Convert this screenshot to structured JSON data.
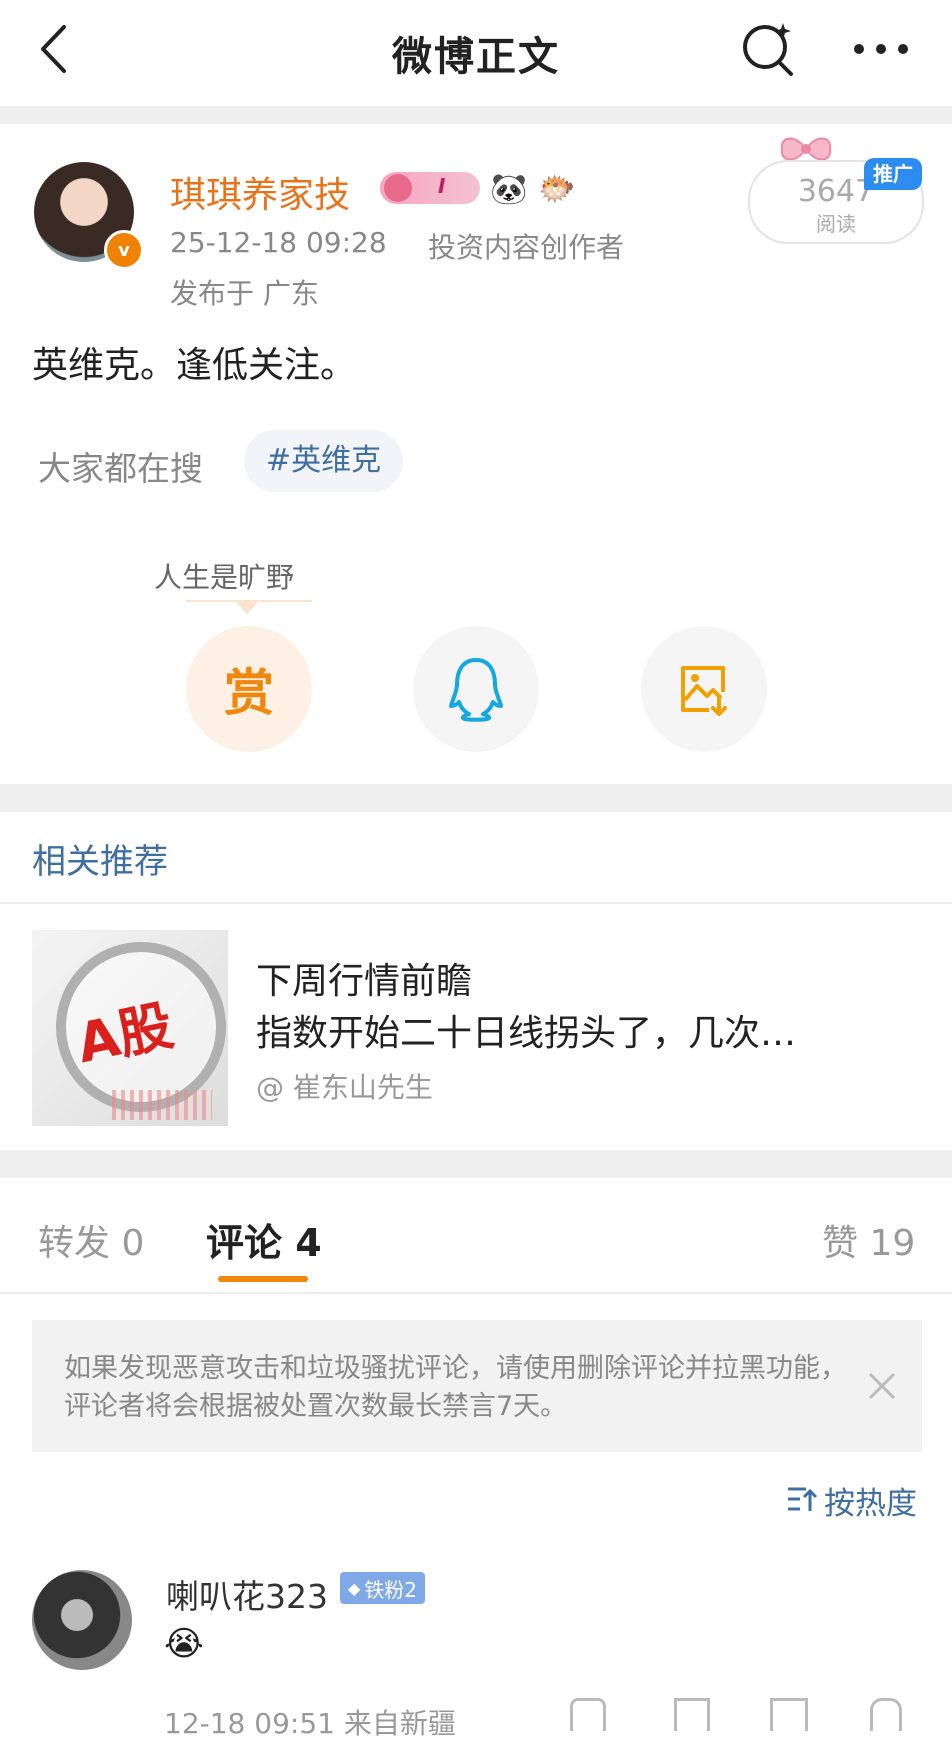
{
  "header": {
    "title": "微博正文"
  },
  "post": {
    "author": "琪琪养家技",
    "timestamp": "25-12-18 09:28",
    "role": "投资内容创作者",
    "location": "发布于 广东",
    "content": "英维克。逢低关注。",
    "search_prefix": "大家都在搜",
    "search_tag": "#英维克",
    "reads_count": "3647",
    "reads_label": "阅读",
    "promo_label": "推广",
    "tip_user": "人生是旷野",
    "reward_label": "赏"
  },
  "related": {
    "title": "相关推荐",
    "thumb_text": "A股",
    "item_title_1": "下周行情前瞻",
    "item_title_2": "指数开始二十日线拐头了，几次…",
    "item_author": "@ 崔东山先生"
  },
  "tabs": {
    "repost": "转发 0",
    "comment": "评论 4",
    "like": "赞 19"
  },
  "notice": {
    "text": "如果发现恶意攻击和垃圾骚扰评论，请使用删除评论并拉黑功能，评论者将会根据被处置次数最长禁言7天。"
  },
  "sort": {
    "label": "按热度"
  },
  "comments": [
    {
      "user": "喇叭花323",
      "badge": "铁粉2",
      "content_emoji": "😭",
      "meta": "12-18 09:51 来自新疆"
    }
  ],
  "colors": {
    "accent_orange": "#f0860a",
    "link_blue": "#3f6fa0",
    "name_orange": "#e8731a",
    "promo_blue": "#2d8cf0"
  }
}
